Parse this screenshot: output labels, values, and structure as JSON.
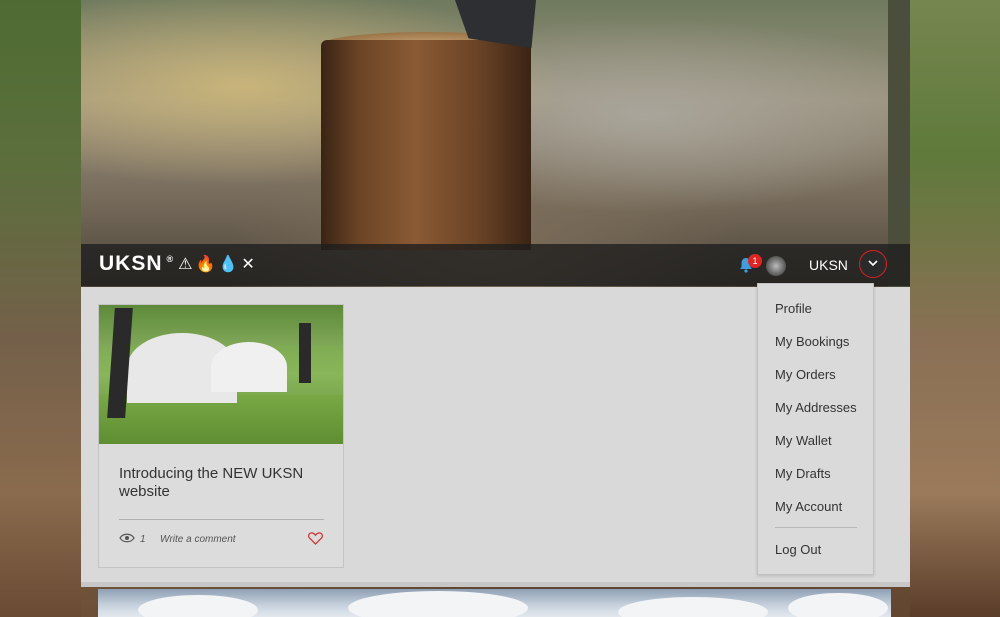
{
  "brand": {
    "logo_text": "UKSN",
    "registered_mark": "®",
    "logo_glyphs": "⚠🔥💧✕"
  },
  "header": {
    "notification_count": "1",
    "user_name": "UKSN",
    "icons": [
      "bell-icon",
      "avatar",
      "chevron-down-icon"
    ]
  },
  "menu": {
    "items": [
      {
        "label": "Profile"
      },
      {
        "label": "My Bookings"
      },
      {
        "label": "My Orders"
      },
      {
        "label": "My Addresses"
      },
      {
        "label": "My Wallet"
      },
      {
        "label": "My Drafts"
      },
      {
        "label": "My Account"
      }
    ],
    "logout_label": "Log Out"
  },
  "post": {
    "title": "Introducing the NEW UKSN website",
    "views": "1",
    "comment_label": "Write a comment",
    "like_color": "#d33a3a"
  },
  "colors": {
    "navbar_bg": "#1e1e1e",
    "content_bg": "#d9d9d9",
    "badge": "#e02424",
    "bell": "#3aa0e0"
  }
}
